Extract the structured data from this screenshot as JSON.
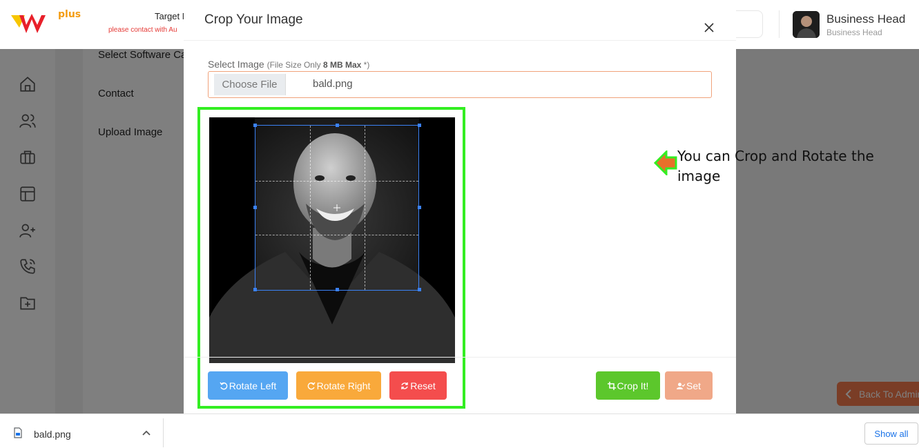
{
  "header": {
    "logo_plus": "plus",
    "target_text": "Target M",
    "contact_warning": "please contact with Au",
    "user_name": "Business Head",
    "user_role": "Business Head"
  },
  "background": {
    "labels": [
      "Select Software Ca",
      "Contact",
      "Upload Image"
    ],
    "back_to_admin": "Back To Admin"
  },
  "sidebar": {
    "icons": [
      "home-icon",
      "users-icon",
      "briefcase-icon",
      "layout-icon",
      "user-plus-icon",
      "phone-icon",
      "folder-plus-icon"
    ]
  },
  "modal": {
    "title": "Crop Your Image",
    "select_label": "Select Image",
    "size_note_prefix": "(File Size Only ",
    "size_note_bold": "8 MB Max",
    "size_note_suffix": " *)",
    "choose_file": "Choose File",
    "file_name": "bald.png",
    "buttons": {
      "rotate_left": "Rotate Left",
      "rotate_right": "Rotate Right",
      "reset": "Reset",
      "crop": "Crop It!",
      "set": "Set"
    },
    "annotation": "You can Crop and Rotate the image"
  },
  "download_bar": {
    "file_name": "bald.png",
    "show_all": "Show all"
  },
  "colors": {
    "accent_orange": "#f47a4c",
    "highlight_green": "#33ee22",
    "rotate_left": "#55a6f2",
    "rotate_right": "#f9a93b",
    "reset": "#f44d4d",
    "crop": "#5cc72c",
    "set": "#f0a888"
  }
}
